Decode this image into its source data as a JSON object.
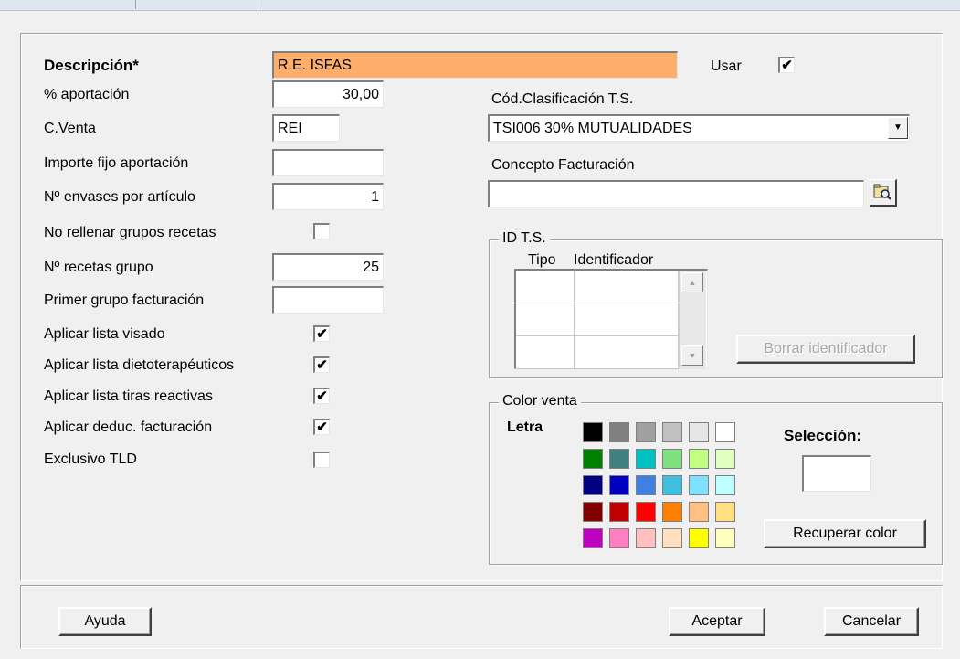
{
  "form": {
    "descripcion_label": "Descripción*",
    "descripcion_value": "R.E. ISFAS",
    "usar_label": "Usar",
    "usar_checked": "✔",
    "aportacion_label": "% aportación",
    "aportacion_value": "30,00",
    "cventa_label": "C.Venta",
    "cventa_value": "REI",
    "importe_label": "Importe fijo aportación",
    "importe_value": "",
    "envases_label": "Nº envases por artículo",
    "envases_value": "1",
    "no_rellenar_label": "No rellenar grupos recetas",
    "no_rellenar_checked": "",
    "recetas_grupo_label": "Nº recetas grupo",
    "recetas_grupo_value": "25",
    "primer_grupo_label": "Primer grupo facturación",
    "primer_grupo_value": "",
    "visado_label": "Aplicar lista visado",
    "visado_checked": "✔",
    "dieto_label": "Aplicar lista dietoterapéuticos",
    "dieto_checked": "✔",
    "tiras_label": "Aplicar lista tiras reactivas",
    "tiras_checked": "✔",
    "deduc_label": "Aplicar deduc. facturación",
    "deduc_checked": "✔",
    "tld_label": "Exclusivo TLD",
    "tld_checked": ""
  },
  "right": {
    "cod_clasif_label": "Cód.Clasificación T.S.",
    "cod_clasif_value": "TSI006 30% MUTUALIDADES",
    "concepto_label": "Concepto Facturación",
    "concepto_value": ""
  },
  "idts": {
    "legend": "ID T.S.",
    "col_tipo": "Tipo",
    "col_identificador": "Identificador",
    "borrar_button": "Borrar identificador"
  },
  "color_venta": {
    "legend": "Color venta",
    "letra_label": "Letra",
    "seleccion_label": "Selección:",
    "recuperar_button": "Recuperar color",
    "palette": [
      [
        "#000000",
        "#808080",
        "#a0a0a0",
        "#c0c0c0",
        "#e6e6e6",
        "#ffffff"
      ],
      [
        "#008000",
        "#408080",
        "#00c0c0",
        "#80e080",
        "#c0ff80",
        "#e0ffc0"
      ],
      [
        "#000080",
        "#0000c0",
        "#4080e0",
        "#40c0e0",
        "#80e0ff",
        "#c0ffff"
      ],
      [
        "#800000",
        "#c00000",
        "#ff0000",
        "#ff8000",
        "#ffc080",
        "#ffe080"
      ],
      [
        "#c000c0",
        "#ff80c0",
        "#ffc0c0",
        "#ffe0c0",
        "#ffff00",
        "#ffffc0"
      ]
    ]
  },
  "footer": {
    "ayuda": "Ayuda",
    "aceptar": "Aceptar",
    "cancelar": "Cancelar"
  }
}
